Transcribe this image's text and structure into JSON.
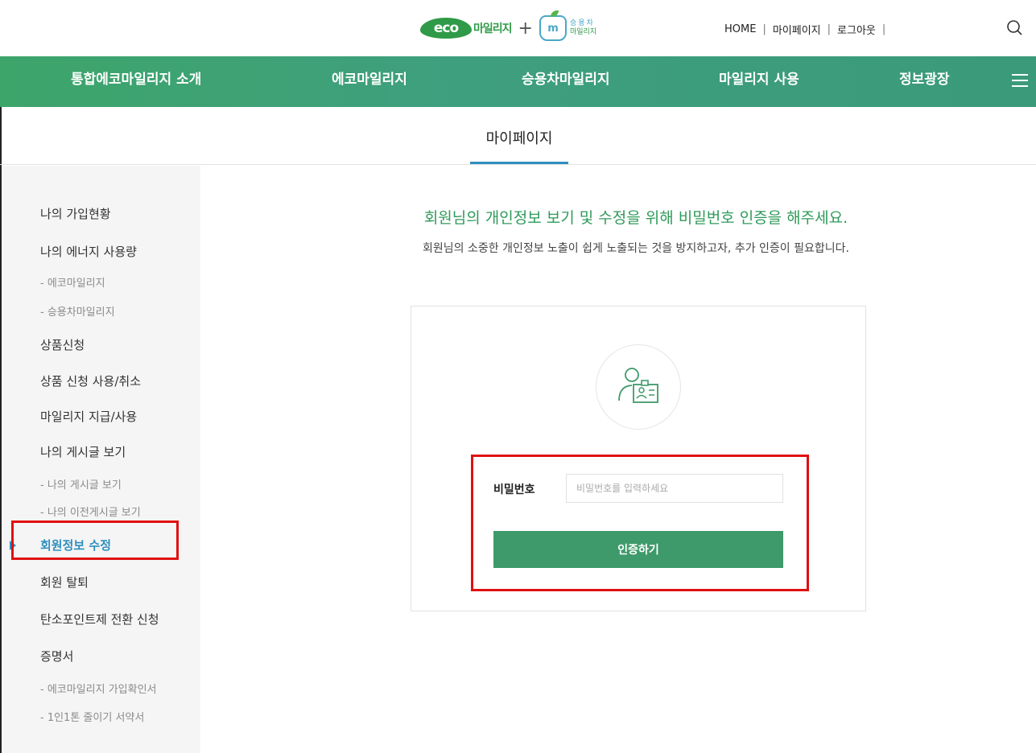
{
  "header": {
    "logo": {
      "eco_label": "eco",
      "eco_text": "마일리지",
      "plus": "+",
      "car_badge": "m",
      "car_line1": "승용차",
      "car_line2": "마일리지"
    },
    "util_links": [
      "HOME",
      "마이페이지",
      "로그아웃"
    ],
    "separator": "|",
    "search_icon": "search-icon"
  },
  "nav": {
    "items": [
      "통합에코마일리지 소개",
      "에코마일리지",
      "승용차마일리지",
      "마일리지 사용",
      "정보광장"
    ],
    "menu_icon": "hamburger-menu-icon",
    "colors": {
      "start": "#3da56a",
      "end": "#3a9a7a"
    }
  },
  "page": {
    "title": "마이페이지",
    "accent": "#2f8fbf"
  },
  "sidebar": {
    "items": [
      {
        "label": "나의 가입현황",
        "type": "main"
      },
      {
        "label": "나의 에너지 사용량",
        "type": "main"
      },
      {
        "label": "- 에코마일리지",
        "type": "sub"
      },
      {
        "label": "- 승용차마일리지",
        "type": "sub"
      },
      {
        "label": "상품신청",
        "type": "main"
      },
      {
        "label": "상품 신청 사용/취소",
        "type": "main"
      },
      {
        "label": "마일리지 지급/사용",
        "type": "main"
      },
      {
        "label": "나의 게시글 보기",
        "type": "main"
      },
      {
        "label": "- 나의 게시글 보기",
        "type": "sub"
      },
      {
        "label": "- 나의 이전게시글 보기",
        "type": "sub"
      },
      {
        "label": "회원정보 수정",
        "type": "main",
        "active": true
      },
      {
        "label": "회원 탈퇴",
        "type": "main"
      },
      {
        "label": "탄소포인트제 전환 신청",
        "type": "main"
      },
      {
        "label": "증명서",
        "type": "main"
      },
      {
        "label": "- 에코마일리지 가입확인서",
        "type": "sub"
      },
      {
        "label": "- 1인1톤 줄이기 서약서",
        "type": "sub"
      }
    ]
  },
  "main": {
    "heading": "회원님의 개인정보 보기 및 수정을 위해 비밀번호 인증을 해주세요.",
    "subheading": "회원님의 소중한 개인정보 노출이 쉽게 노출되는 것을 방지하고자, 추가 인증이 필요합니다.",
    "card_icon": "user-id-card-icon",
    "password": {
      "label": "비밀번호",
      "placeholder": "비밀번호를 입력하세요",
      "value": ""
    },
    "submit_label": "인증하기",
    "button_color": "#3e9a6a",
    "heading_color": "#2f9a5a"
  },
  "highlight_color": "#e01010"
}
